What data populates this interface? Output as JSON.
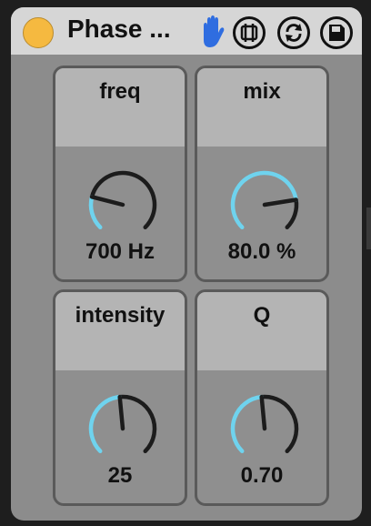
{
  "device": {
    "title": "Phase ...",
    "power_on": true,
    "accent_color": "#6fd3ee",
    "power_color": "#f5b940",
    "header_icons": [
      "hand-icon",
      "freeze-icon",
      "refresh-icon",
      "save-icon"
    ]
  },
  "knobs": [
    {
      "label": "freq",
      "value": "700 Hz",
      "fraction": 0.22
    },
    {
      "label": "mix",
      "value": "80.0 %",
      "fraction": 0.8
    },
    {
      "label": "intensity",
      "value": "25",
      "fraction": 0.48
    },
    {
      "label": "Q",
      "value": "0.70",
      "fraction": 0.48
    }
  ]
}
